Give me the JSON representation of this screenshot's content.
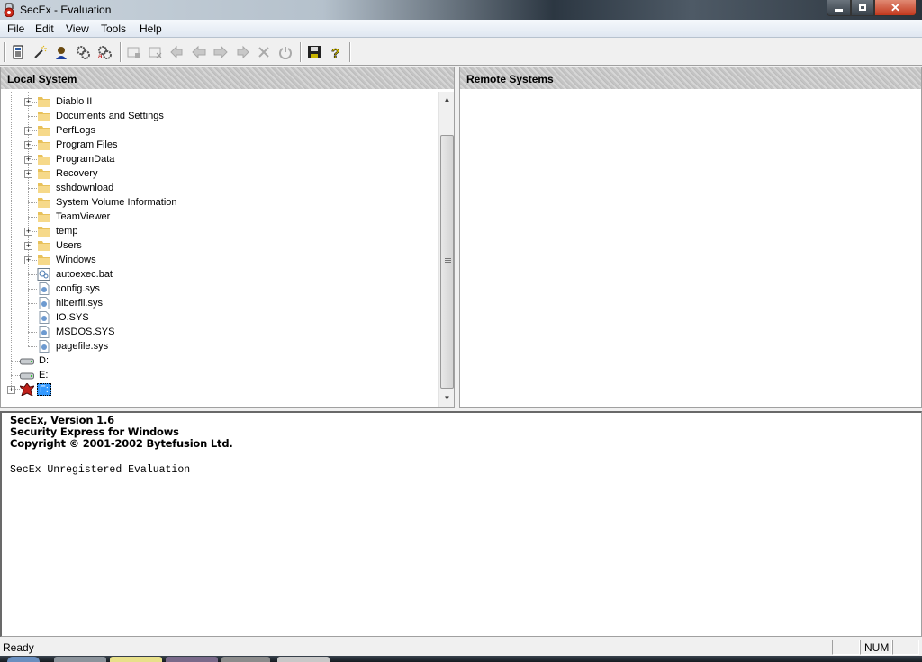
{
  "window": {
    "title": "SecEx - Evaluation",
    "icon": "padlock-app-icon",
    "controls": {
      "minimize": "minimize-icon",
      "maximize": "restore-icon",
      "close": "close-icon"
    }
  },
  "menu": [
    "File",
    "Edit",
    "View",
    "Tools",
    "Help"
  ],
  "toolbar": {
    "buttons": [
      {
        "name": "properties",
        "icon": "document-list-icon",
        "enabled": true
      },
      {
        "name": "wizard",
        "icon": "magic-wand-icon",
        "enabled": true
      },
      {
        "name": "user",
        "icon": "user-icon",
        "enabled": true
      },
      {
        "name": "settings",
        "icon": "gears-icon",
        "enabled": true
      },
      {
        "name": "advanced-settings",
        "icon": "gears-a-icon",
        "enabled": true
      },
      {
        "name": "lock-window",
        "icon": "window-lock-icon",
        "enabled": false
      },
      {
        "name": "close-window",
        "icon": "window-close-icon",
        "enabled": false
      },
      {
        "name": "back-first",
        "icon": "arrow-left-first-icon",
        "enabled": false
      },
      {
        "name": "back",
        "icon": "arrow-left-icon",
        "enabled": false
      },
      {
        "name": "forward",
        "icon": "arrow-right-icon",
        "enabled": false
      },
      {
        "name": "forward-last",
        "icon": "arrow-right-last-icon",
        "enabled": false
      },
      {
        "name": "delete",
        "icon": "x-delete-icon",
        "enabled": false
      },
      {
        "name": "power",
        "icon": "power-icon",
        "enabled": false
      },
      {
        "name": "save",
        "icon": "floppy-disk-icon",
        "enabled": true
      },
      {
        "name": "help",
        "icon": "question-mark-icon",
        "enabled": true
      }
    ]
  },
  "local_pane": {
    "title": "Local System",
    "tree": [
      {
        "label": "Diablo II",
        "type": "folder",
        "expandable": true
      },
      {
        "label": "Documents and Settings",
        "type": "folder",
        "expandable": false
      },
      {
        "label": "PerfLogs",
        "type": "folder",
        "expandable": true
      },
      {
        "label": "Program Files",
        "type": "folder",
        "expandable": true
      },
      {
        "label": "ProgramData",
        "type": "folder",
        "expandable": true
      },
      {
        "label": "Recovery",
        "type": "folder",
        "expandable": true
      },
      {
        "label": "sshdownload",
        "type": "folder",
        "expandable": false
      },
      {
        "label": "System Volume Information",
        "type": "folder",
        "expandable": false
      },
      {
        "label": "TeamViewer",
        "type": "folder",
        "expandable": false
      },
      {
        "label": "temp",
        "type": "folder",
        "expandable": true
      },
      {
        "label": "Users",
        "type": "folder",
        "expandable": true
      },
      {
        "label": "Windows",
        "type": "folder",
        "expandable": true
      },
      {
        "label": "autoexec.bat",
        "type": "batch-file",
        "expandable": false
      },
      {
        "label": "config.sys",
        "type": "system-file",
        "expandable": false
      },
      {
        "label": "hiberfil.sys",
        "type": "system-file",
        "expandable": false
      },
      {
        "label": "IO.SYS",
        "type": "system-file",
        "expandable": false
      },
      {
        "label": "MSDOS.SYS",
        "type": "system-file",
        "expandable": false
      },
      {
        "label": "pagefile.sys",
        "type": "system-file",
        "expandable": false
      }
    ],
    "drives": [
      {
        "label": "D:",
        "type": "drive",
        "expandable": false,
        "selected": false
      },
      {
        "label": "E:",
        "type": "drive",
        "expandable": false,
        "selected": false
      },
      {
        "label": "F:",
        "type": "custom-drive",
        "expandable": true,
        "selected": true
      }
    ]
  },
  "remote_pane": {
    "title": "Remote Systems"
  },
  "log": {
    "lines_bold": [
      "SecEx, Version 1.6",
      "Security Express for Windows",
      "Copyright © 2001-2002 Bytefusion Ltd."
    ],
    "line_mono": "SecEx Unregistered Evaluation"
  },
  "status": {
    "text": "Ready",
    "indicators": [
      "",
      "NUM",
      ""
    ]
  }
}
